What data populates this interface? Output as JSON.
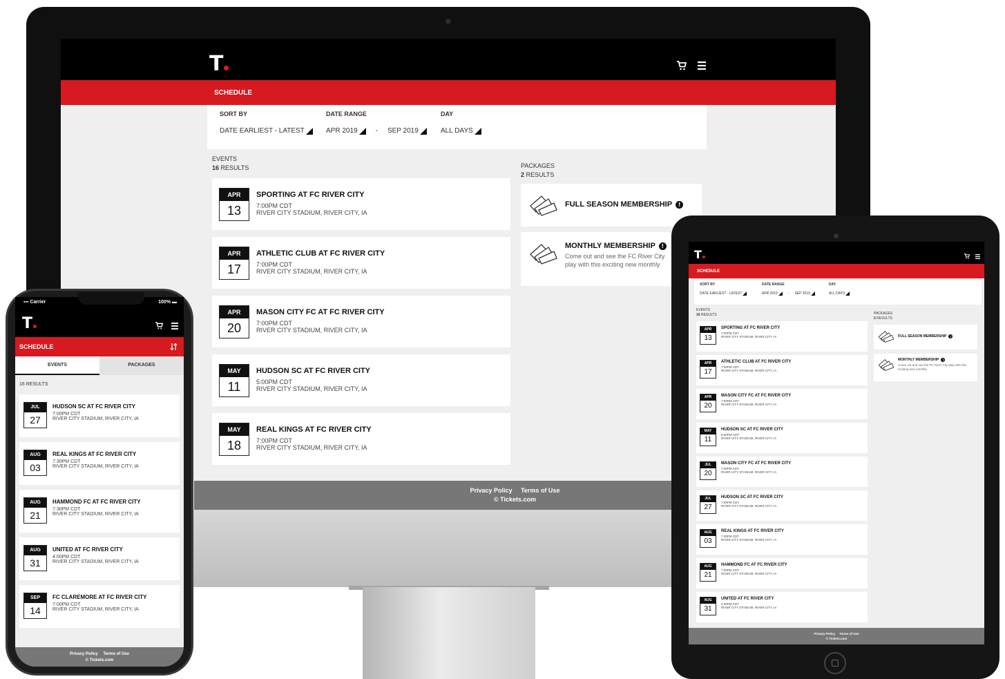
{
  "brand": {
    "logo_letter": "T",
    "accent_color": "#d71920"
  },
  "header": {
    "cart_icon": "cart-icon",
    "menu_icon": "hamburger-menu-icon"
  },
  "schedule": {
    "title": "SCHEDULE"
  },
  "filters": {
    "sort_by": {
      "label": "SORT BY",
      "value": "DATE EARLIEST - LATEST"
    },
    "date_range": {
      "label": "DATE RANGE",
      "from": "APR 2019",
      "separator": "-",
      "to": "SEP 2019"
    },
    "day": {
      "label": "DAY",
      "value": "ALL DAYS"
    }
  },
  "events": {
    "label": "EVENTS",
    "results_count": "16",
    "results_word": "RESULTS"
  },
  "packages": {
    "label": "PACKAGES",
    "results_count": "2",
    "results_word": "RESULTS"
  },
  "desktop_events": [
    {
      "month": "APR",
      "day": "13",
      "title": "SPORTING AT FC RIVER CITY",
      "time": "7:00PM CDT",
      "venue": "RIVER CITY STADIUM, RIVER CITY, IA"
    },
    {
      "month": "APR",
      "day": "17",
      "title": "ATHLETIC CLUB AT FC RIVER CITY",
      "time": "7:00PM CDT",
      "venue": "RIVER CITY STADIUM, RIVER CITY, IA"
    },
    {
      "month": "APR",
      "day": "20",
      "title": "MASON CITY FC AT FC RIVER CITY",
      "time": "7:00PM CDT",
      "venue": "RIVER CITY STADIUM, RIVER CITY, IA"
    },
    {
      "month": "MAY",
      "day": "11",
      "title": "HUDSON SC AT FC RIVER CITY",
      "time": "5:00PM CDT",
      "venue": "RIVER CITY STADIUM, RIVER CITY, IA"
    },
    {
      "month": "MAY",
      "day": "18",
      "title": "REAL KINGS AT FC RIVER CITY",
      "time": "7:00PM CDT",
      "venue": "RIVER CITY STADIUM, RIVER CITY, IA"
    }
  ],
  "package_items": [
    {
      "title": "FULL SEASON MEMBERSHIP",
      "description": ""
    },
    {
      "title": "MONTHLY MEMBERSHIP",
      "description": "Come out and see the FC River City play with this exciting new monthly"
    }
  ],
  "tablet_packages": [
    {
      "title": "FULL SEASON MEMBERSHIP",
      "description": ""
    },
    {
      "title": "MONTHLY MEMBERSHIP",
      "description": "Come out and see the FC River City play with this exciting new monthly"
    }
  ],
  "tablet_events": [
    {
      "month": "APR",
      "day": "13",
      "title": "SPORTING AT FC RIVER CITY",
      "time": "7:00PM CDT",
      "venue": "RIVER CITY STADIUM, RIVER CITY, IA"
    },
    {
      "month": "APR",
      "day": "17",
      "title": "ATHLETIC CLUB AT FC RIVER CITY",
      "time": "7:00PM CDT",
      "venue": "RIVER CITY STADIUM, RIVER CITY, IA"
    },
    {
      "month": "APR",
      "day": "20",
      "title": "MASON CITY FC AT FC RIVER CITY",
      "time": "7:00PM CDT",
      "venue": "RIVER CITY STADIUM, RIVER CITY, IA"
    },
    {
      "month": "MAY",
      "day": "11",
      "title": "HUDSON SC AT FC RIVER CITY",
      "time": "5:00PM CDT",
      "venue": "RIVER CITY STADIUM, RIVER CITY, IA"
    },
    {
      "month": "JUL",
      "day": "20",
      "title": "MASON CITY FC AT FC RIVER CITY",
      "time": "7:00PM CDT",
      "venue": "RIVER CITY STADIUM, RIVER CITY, IA"
    },
    {
      "month": "JUL",
      "day": "27",
      "title": "HUDSON SC AT FC RIVER CITY",
      "time": "7:00PM CDT",
      "venue": "RIVER CITY STADIUM, RIVER CITY, IA"
    },
    {
      "month": "AUG",
      "day": "03",
      "title": "REAL KINGS AT FC RIVER CITY",
      "time": "7:30PM CDT",
      "venue": "RIVER CITY STADIUM, RIVER CITY, IA"
    },
    {
      "month": "AUG",
      "day": "21",
      "title": "HAMMOND FC AT FC RIVER CITY",
      "time": "7:30PM CDT",
      "venue": "RIVER CITY STADIUM, RIVER CITY, IA"
    },
    {
      "month": "AUG",
      "day": "31",
      "title": "UNITED AT FC RIVER CITY",
      "time": "4:00PM CDT",
      "venue": "RIVER CITY STADIUM, RIVER CITY, IA"
    }
  ],
  "phone_events": [
    {
      "month": "JUL",
      "day": "27",
      "title": "HUDSON SC AT FC RIVER CITY",
      "time": "7:00PM CDT",
      "venue": "RIVER CITY STADIUM, RIVER CITY, IA"
    },
    {
      "month": "AUG",
      "day": "03",
      "title": "REAL KINGS AT FC RIVER CITY",
      "time": "7:30PM CDT",
      "venue": "RIVER CITY STADIUM, RIVER CITY, IA"
    },
    {
      "month": "AUG",
      "day": "21",
      "title": "HAMMOND FC AT FC RIVER CITY",
      "time": "7:30PM CDT",
      "venue": "RIVER CITY STADIUM, RIVER CITY, IA"
    },
    {
      "month": "AUG",
      "day": "31",
      "title": "UNITED AT FC RIVER CITY",
      "time": "4:00PM CDT",
      "venue": "RIVER CITY STADIUM, RIVER CITY, IA"
    },
    {
      "month": "SEP",
      "day": "14",
      "title": "FC CLAREMORE AT FC RIVER CITY",
      "time": "7:00PM CDT",
      "venue": "RIVER CITY STADIUM, RIVER CITY, IA"
    }
  ],
  "phone": {
    "carrier": "Carrier",
    "battery": "100%",
    "tabs": [
      "EVENTS",
      "PACKAGES"
    ],
    "results": "16 RESULTS"
  },
  "footer": {
    "privacy": "Privacy Policy",
    "terms": "Terms of Use",
    "copyright": "© Tickets.com"
  }
}
